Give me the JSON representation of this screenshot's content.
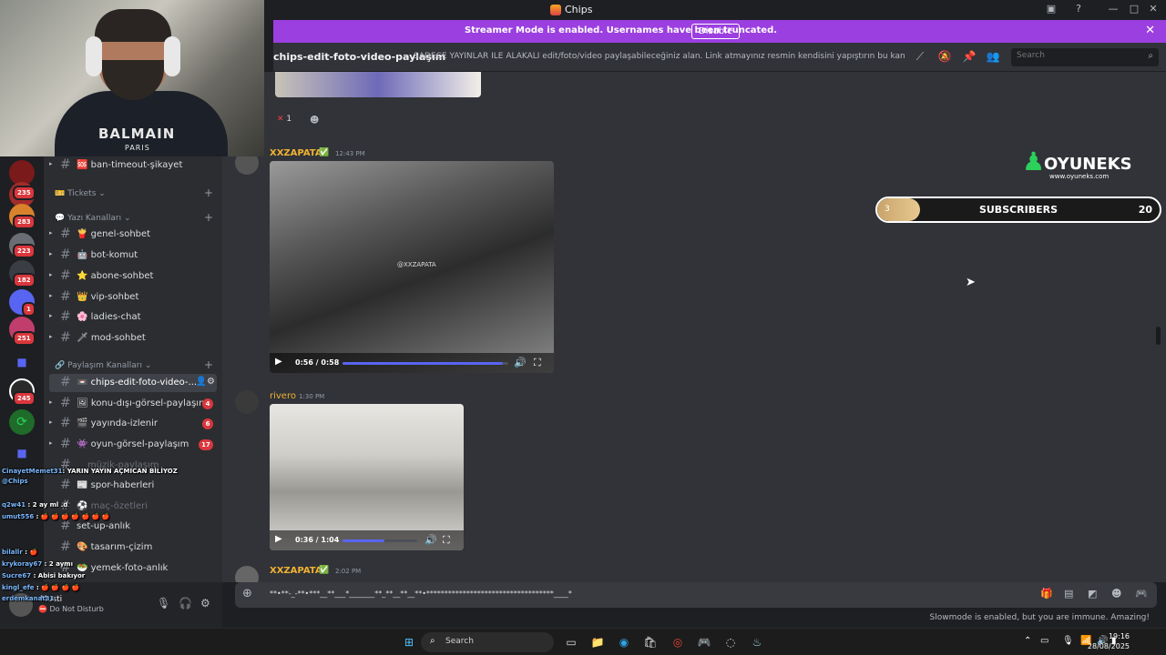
{
  "window": {
    "title": "Chips"
  },
  "banner": {
    "message": "Streamer Mode is enabled. Usernames have been truncated.",
    "disable_label": "Disable"
  },
  "channel_header": {
    "name": "chips-edit-foto-video-paylaşım",
    "topic": "SADECE YAYINLAR İLE ALAKALI edit/foto/video paylaşabileceğiniz alan. Link atmayınız resmin kendisini yapıştırın bu kanala lütfen, ...",
    "search_placeholder": "Search"
  },
  "servers": {
    "badges": [
      "235",
      "283",
      "223",
      "182",
      "1",
      "251",
      "245"
    ]
  },
  "sidebar": {
    "top_channel": {
      "label": "ban-timeout-şikayet"
    },
    "categories": [
      {
        "label": "Tickets"
      },
      {
        "label": "Yazı Kanalları"
      },
      {
        "label": "Paylaşım Kanalları"
      }
    ],
    "text_channels": [
      {
        "label": "genel-sohbet",
        "emoji": "🍟"
      },
      {
        "label": "bot-komut",
        "emoji": "🤖"
      },
      {
        "label": "abone-sohbet",
        "emoji": "⭐"
      },
      {
        "label": "vip-sohbet",
        "emoji": "👑"
      },
      {
        "label": "ladies-chat",
        "emoji": "🌸"
      },
      {
        "label": "mod-sohbet",
        "emoji": "🗡"
      }
    ],
    "share_channels": [
      {
        "label": "chips-edit-foto-video-...",
        "emoji": "📼",
        "active": true
      },
      {
        "label": "konu-dışı-görsel-paylaşım",
        "emoji": "🖼",
        "unread": "4"
      },
      {
        "label": "yayında-izlenir",
        "emoji": "🎬",
        "unread": "6"
      },
      {
        "label": "oyun-görsel-paylaşım",
        "emoji": "👾",
        "unread": "17"
      },
      {
        "label": "müzik-paylaşım",
        "emoji": "",
        "muted": true
      },
      {
        "label": "spor-haberleri",
        "emoji": "📰"
      },
      {
        "label": "maç-özetleri",
        "emoji": "⚽",
        "muted": true
      },
      {
        "label": "set-up-anlık",
        "emoji": ""
      },
      {
        "label": "tasarım-çizim",
        "emoji": "🎨"
      },
      {
        "label": "yemek-foto-anlık",
        "emoji": "🥗"
      }
    ]
  },
  "user_panel": {
    "name": "Musti",
    "status": "Do Not Disturb"
  },
  "webcam": {
    "shirt_brand": "BALMAIN",
    "shirt_sub": "PARIS"
  },
  "messages": [
    {
      "reaction_count": "1"
    },
    {
      "author": "XXZAPATA",
      "time": "12:43 PM",
      "author_color": "#f0b232",
      "video": {
        "time": "0:56 / 0:58",
        "progress": 0.965,
        "watermark": "@XXZAPATA"
      }
    },
    {
      "author": "rivero",
      "time": "1:30 PM",
      "author_color": "#f0b232",
      "video": {
        "time": "0:36 / 1:04",
        "progress": 0.56
      }
    },
    {
      "author": "XXZAPATA",
      "time": "2:02 PM",
      "author_color": "#f0b232"
    }
  ],
  "overlay": {
    "logo_name": "OYUNEKS",
    "logo_url": "www.oyuneks.com",
    "subscribers": {
      "label": "SUBSCRIBERS",
      "current": "3",
      "goal": "20",
      "progress": 0.15
    }
  },
  "composer": {
    "text": "**•**-_-**•***__**___*_______**_**__**__**•***********************************____*"
  },
  "slowmode": "Slowmode is enabled, but you are immune. Amazing!",
  "twitch_chat": [
    {
      "user": "CinayetMemet31",
      "text": ": YARIN YAYIN AÇMICAN BİLİYOZ"
    },
    {
      "user": "@Chips",
      "text": ""
    },
    {
      "user": "q2w41",
      "text": ": 2 ay ml .d"
    },
    {
      "user": "umut556",
      "text": ": 🍎 🍎 🍎 🍎 🍎 🍎 🍎"
    },
    {
      "user": "bilallr",
      "text": ": 🍎"
    },
    {
      "user": "krykoray67",
      "text": ": 2 aymı"
    },
    {
      "user": "Sucre67",
      "text": ": Abisi bakıyor"
    },
    {
      "user": "kingl_efe",
      "text": ": 🍎 🍎 🍎 🍎"
    },
    {
      "user": "erdemkanat31",
      "text": ""
    }
  ],
  "taskbar": {
    "search_label": "Search",
    "time": "19:16",
    "date": "28/08/2025"
  }
}
